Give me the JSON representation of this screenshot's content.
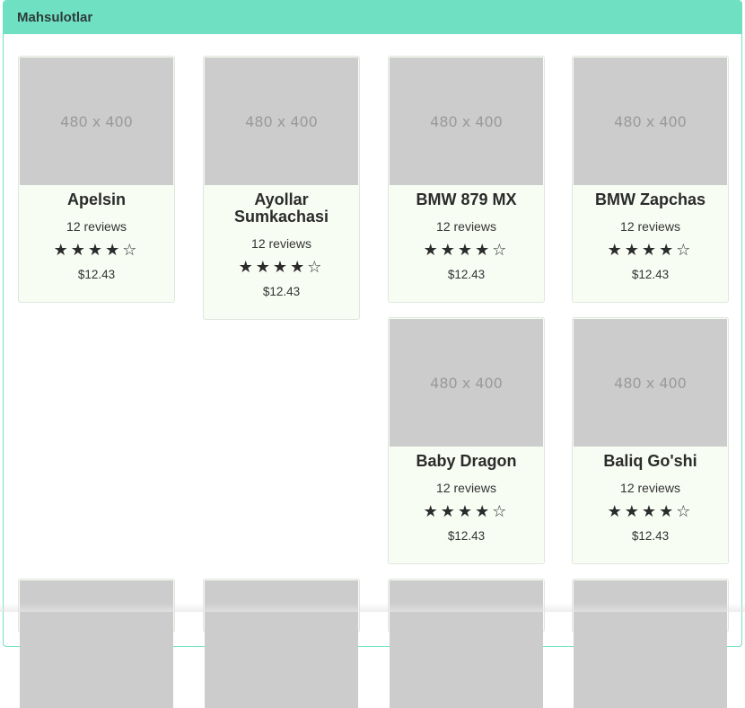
{
  "panel": {
    "title": "Mahsulotlar"
  },
  "placeholder_text": "480 x 400",
  "products": [
    {
      "name": "Apelsin",
      "reviews": "12 reviews",
      "stars": "★★★★☆",
      "price": "$12.43"
    },
    {
      "name": "Ayollar Sumkachasi",
      "reviews": "12 reviews",
      "stars": "★★★★☆",
      "price": "$12.43"
    },
    {
      "name": "BMW 879 MX",
      "reviews": "12 reviews",
      "stars": "★★★★☆",
      "price": "$12.43"
    },
    {
      "name": "BMW Zapchas",
      "reviews": "12 reviews",
      "stars": "★★★★☆",
      "price": "$12.43"
    },
    {
      "name": "Baby Dragon",
      "reviews": "12 reviews",
      "stars": "★★★★☆",
      "price": "$12.43"
    },
    {
      "name": "Baliq Go'shi",
      "reviews": "12 reviews",
      "stars": "★★★★☆",
      "price": "$12.43"
    }
  ]
}
